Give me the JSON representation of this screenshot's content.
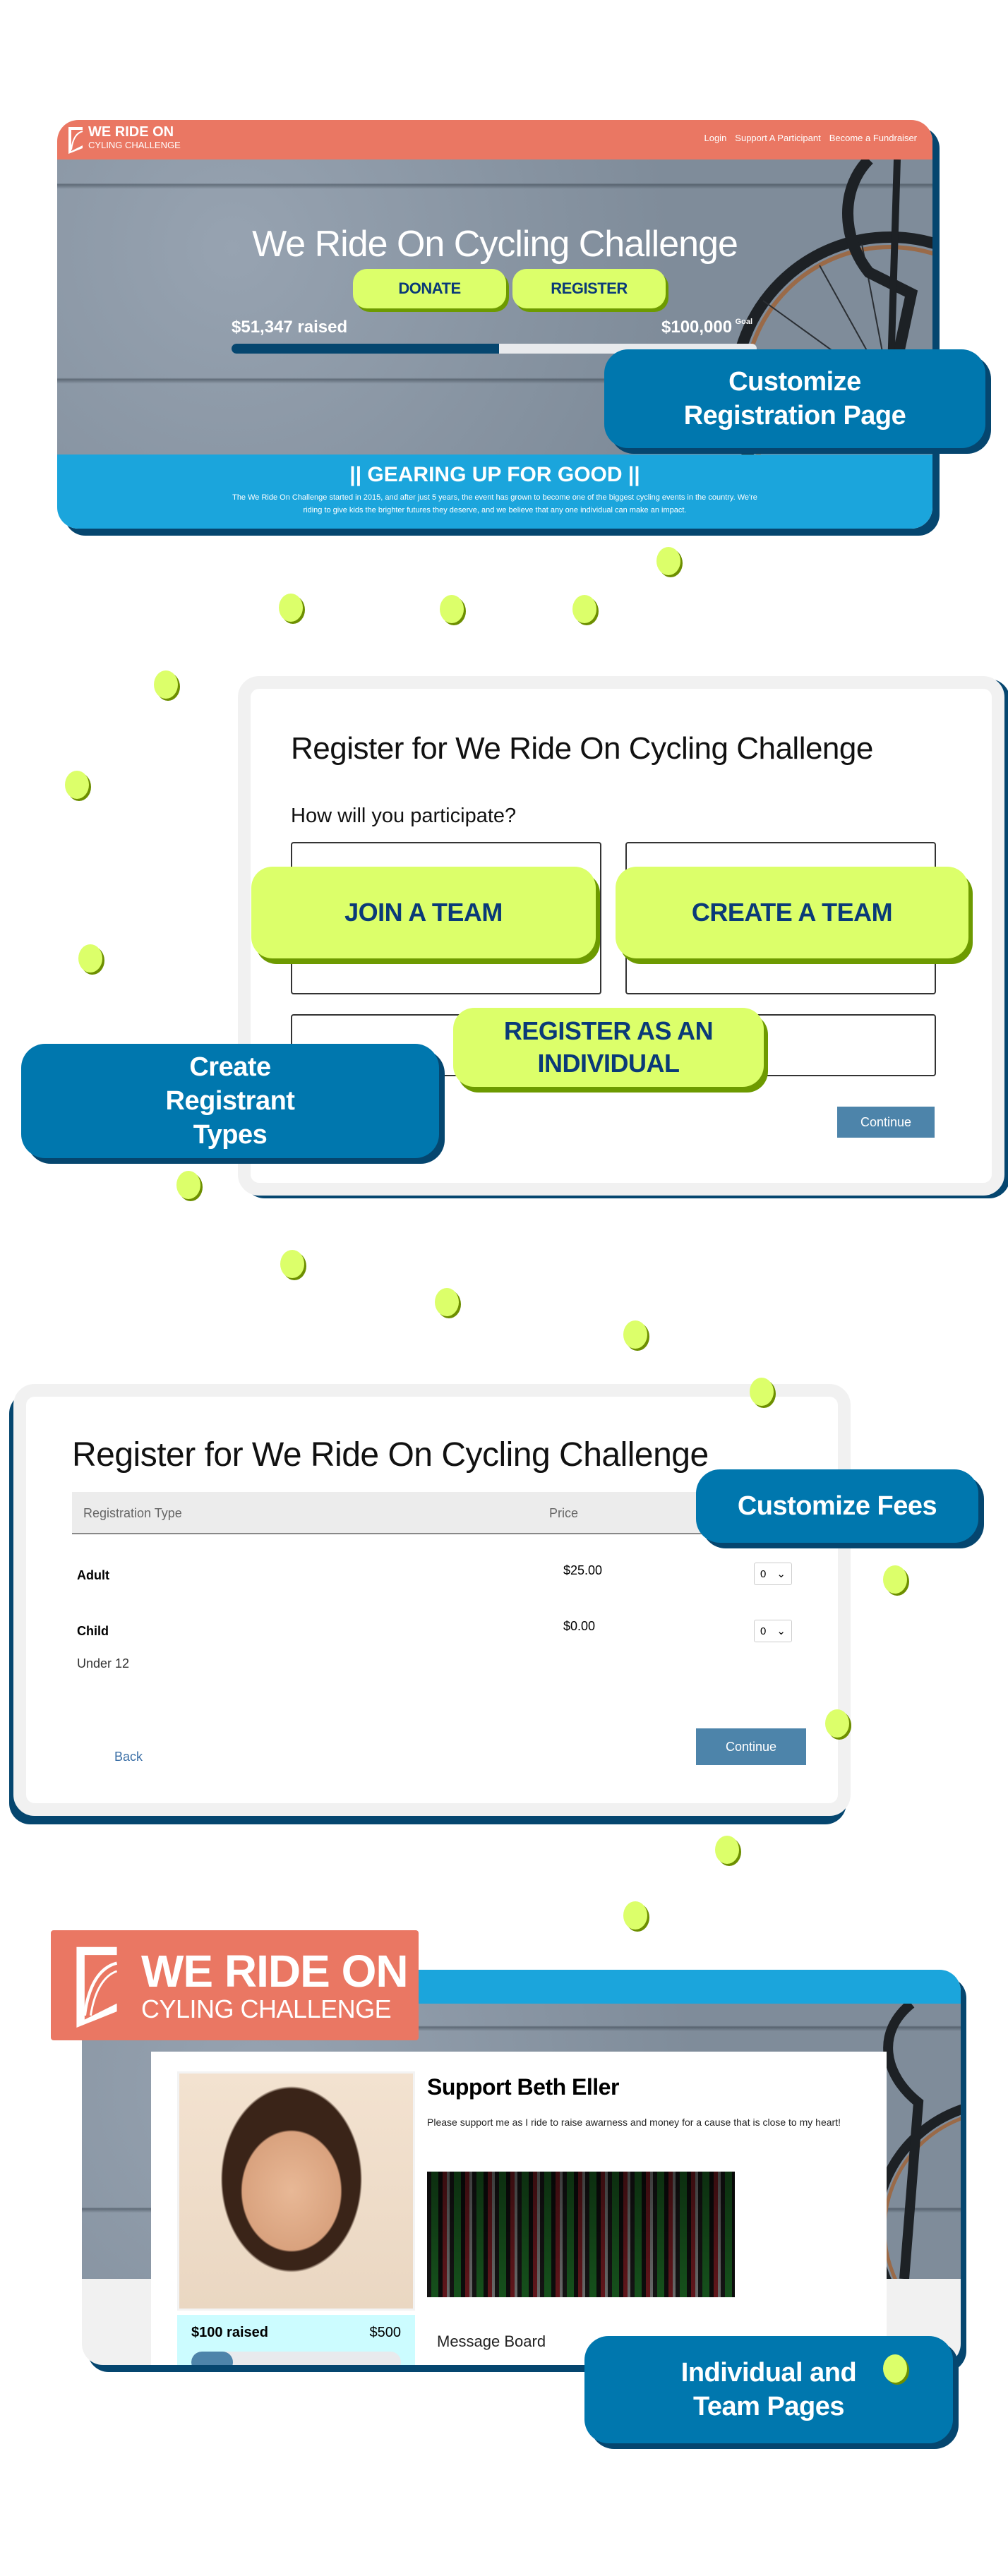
{
  "colors": {
    "coral": "#ea7763",
    "sky": "#1ba5dc",
    "callout": "#0077ae",
    "navy": "#05466f",
    "lime": "#dcff6a",
    "button": "#4d84aa"
  },
  "section1": {
    "logo": {
      "line1": "WE RIDE ON",
      "line2": "CYLING CHALLENGE"
    },
    "nav": [
      "Login",
      "Support A Participant",
      "Become a Fundraiser"
    ],
    "hero_title": "We Ride On Cycling Challenge",
    "donate_label": "DONATE",
    "register_label": "REGISTER",
    "raised": "$51,347 raised",
    "goal_amount": "$100,000",
    "goal_label": "Goal",
    "progress_percent": 51,
    "banner_title": "|| GEARING UP FOR GOOD ||",
    "banner_text": "The We Ride On Challenge started in 2015, and after just 5 years, the event has grown to become one of the biggest cycling events in the country. We're riding to give kids the brighter futures they deserve, and we believe that any one individual can make an impact.",
    "callout": "Customize Registration Page"
  },
  "section2": {
    "title": "Register for We Ride On Cycling Challenge",
    "question": "How will you participate?",
    "options": [
      "JOIN A TEAM",
      "CREATE A TEAM",
      "REGISTER AS AN INDIVIDUAL"
    ],
    "continue_label": "Continue",
    "callout": "Create Registrant Types"
  },
  "section3": {
    "title": "Register for We Ride On Cycling Challenge",
    "columns": [
      "Registration Type",
      "Price"
    ],
    "rows": [
      {
        "type": "Adult",
        "price": "$25.00",
        "qty": "0",
        "note": ""
      },
      {
        "type": "Child",
        "price": "$0.00",
        "qty": "0",
        "note": "Under 12"
      }
    ],
    "back_label": "Back",
    "continue_label": "Continue",
    "callout": "Customize Fees"
  },
  "section4": {
    "logo": {
      "line1": "WE RIDE ON",
      "line2": "CYLING CHALLENGE"
    },
    "page_title": "Support Beth Eller",
    "description": "Please support me as I ride to raise awarness and money for a cause that is close to my heart!",
    "raised": "$100 raised",
    "goal": "$500",
    "progress_percent": 20,
    "message_board": "Message Board",
    "callout": "Individual and Team Pages"
  }
}
